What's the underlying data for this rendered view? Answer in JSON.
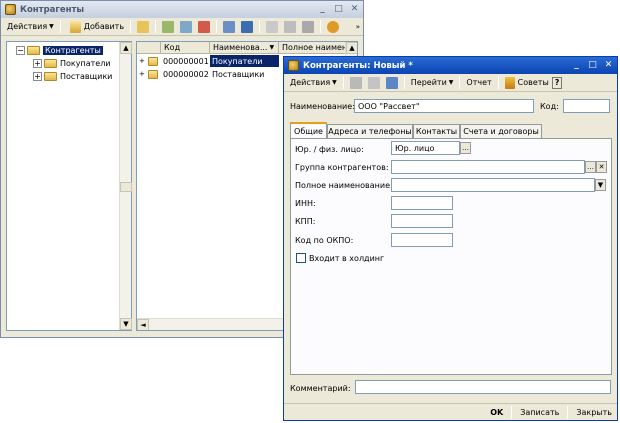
{
  "list_window": {
    "title": "Контрагенты",
    "toolbar": {
      "actions": "Действия",
      "add": "Добавить"
    },
    "tree": {
      "root": "Контрагенты",
      "children": [
        "Покупатели",
        "Поставщики"
      ]
    },
    "grid": {
      "headers": [
        "Код",
        "Наименова...",
        "Полное наимен"
      ],
      "rows": [
        {
          "code": "000000001",
          "name": "Покупатели"
        },
        {
          "code": "000000002",
          "name": "Поставщики"
        }
      ]
    }
  },
  "form_window": {
    "title": "Контрагенты: Новый *",
    "toolbar": {
      "actions": "Действия",
      "goto": "Перейти",
      "report": "Отчет",
      "tips": "Советы",
      "help": "?"
    },
    "name_label": "Наименование:",
    "name_value": "ООО \"Рассвет\"",
    "code_label": "Код:",
    "code_value": "",
    "tabs": [
      "Общие",
      "Адреса и телефоны",
      "Контакты",
      "Счета и договоры"
    ],
    "fields": {
      "legal_label": "Юр. / физ. лицо:",
      "legal_value": "Юр. лицо",
      "group_label": "Группа контрагентов:",
      "fullname_label": "Полное наименование:",
      "inn_label": "ИНН:",
      "kpp_label": "КПП:",
      "okpo_label": "Код по ОКПО:",
      "holding_label": "Входит в холдинг"
    },
    "comment_label": "Комментарий:",
    "buttons": {
      "ok": "OK",
      "save": "Записать",
      "close": "Закрыть"
    }
  }
}
